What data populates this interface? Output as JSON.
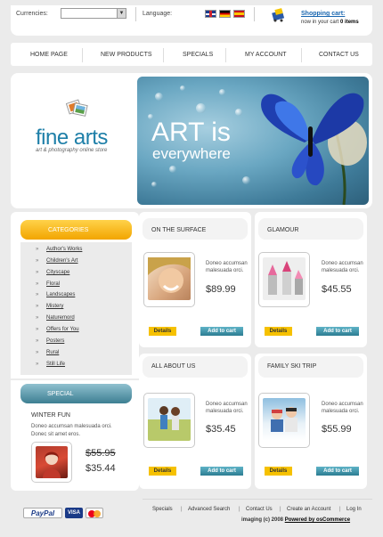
{
  "header": {
    "currencies_label": "Currencies:",
    "language_label": "Language:",
    "cart_title": "Shopping cart:",
    "cart_text": "now in your cart",
    "cart_count": "0 items"
  },
  "nav": [
    "HOME PAGE",
    "NEW PRODUCTS",
    "SPECIALS",
    "MY ACCOUNT",
    "CONTACT US"
  ],
  "hero": {
    "logo": "fine arts",
    "tagline": "art & photography online store",
    "banner_line1": "ART is",
    "banner_line2": "everywhere"
  },
  "categories": {
    "title": "CATEGORIES",
    "items": [
      "Author's Works",
      "Children's Art",
      "Cityscape",
      "Floral",
      "Landscapes",
      "Mistery",
      "Naturemord",
      "Offers for You",
      "Posters",
      "Rural",
      "Still Life"
    ]
  },
  "special": {
    "title": "SPECIAL",
    "name": "WINTER FUN",
    "desc": "Doneo accumsan malesuada orci. Donec sit amet eros.",
    "old_price": "$55.95",
    "new_price": "$35.44"
  },
  "products": [
    {
      "title": "ON THE SURFACE",
      "desc": "Doneo accumsan malesuada orci.",
      "price": "$89.99",
      "details": "Details",
      "add": "Add to cart",
      "image": "smiling-woman"
    },
    {
      "title": "GLAMOUR",
      "desc": "Doneo accumsan malesuada orci.",
      "price": "$45.55",
      "details": "Details",
      "add": "Add to cart",
      "image": "lipsticks"
    },
    {
      "title": "ALL ABOUT US",
      "desc": "Doneo accumsan malesuada orci.",
      "price": "$35.45",
      "details": "Details",
      "add": "Add to cart",
      "image": "children-field"
    },
    {
      "title": "FAMILY SKI TRIP",
      "desc": "Doneo accumsan malesuada orci.",
      "price": "$55.99",
      "details": "Details",
      "add": "Add to cart",
      "image": "ski-family"
    }
  ],
  "footer": {
    "links": [
      "Specials",
      "Advanced Search",
      "Contact Us",
      "Create an Account",
      "Log In"
    ],
    "copyright": "imaging (c) 2008",
    "powered": "Powered by osCommerce",
    "payments": [
      "PayPal",
      "VISA",
      "MasterCard"
    ]
  },
  "colors": {
    "accent_blue": "#1e7fa8",
    "category_orange": "#f2a500",
    "special_teal": "#3d7f92",
    "details_yellow": "#f6c100"
  }
}
